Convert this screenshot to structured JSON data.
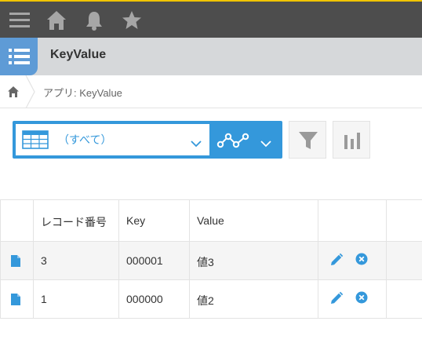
{
  "header": {
    "icons": [
      "menu-icon",
      "home-icon",
      "bell-icon",
      "star-icon"
    ],
    "accent_color": "#f0c400",
    "bar_color": "#4d4d4d"
  },
  "app": {
    "title": "KeyValue",
    "icon": "app-list-icon",
    "icon_color": "#5e9bd6"
  },
  "breadcrumb": {
    "home_icon": "home-icon",
    "text": "アプリ: KeyValue"
  },
  "view": {
    "selected": "（すべて）",
    "icon": "table-view-icon",
    "graph_icon": "line-graph-icon",
    "accent_color": "#3498db"
  },
  "toolbar": {
    "filter_icon": "filter-icon",
    "chart_icon": "bar-chart-icon"
  },
  "table": {
    "columns": [
      "レコード番号",
      "Key",
      "Value"
    ],
    "rows": [
      {
        "record": "3",
        "key": "000001",
        "value": "値3"
      },
      {
        "record": "1",
        "key": "000000",
        "value": "値2"
      }
    ]
  }
}
